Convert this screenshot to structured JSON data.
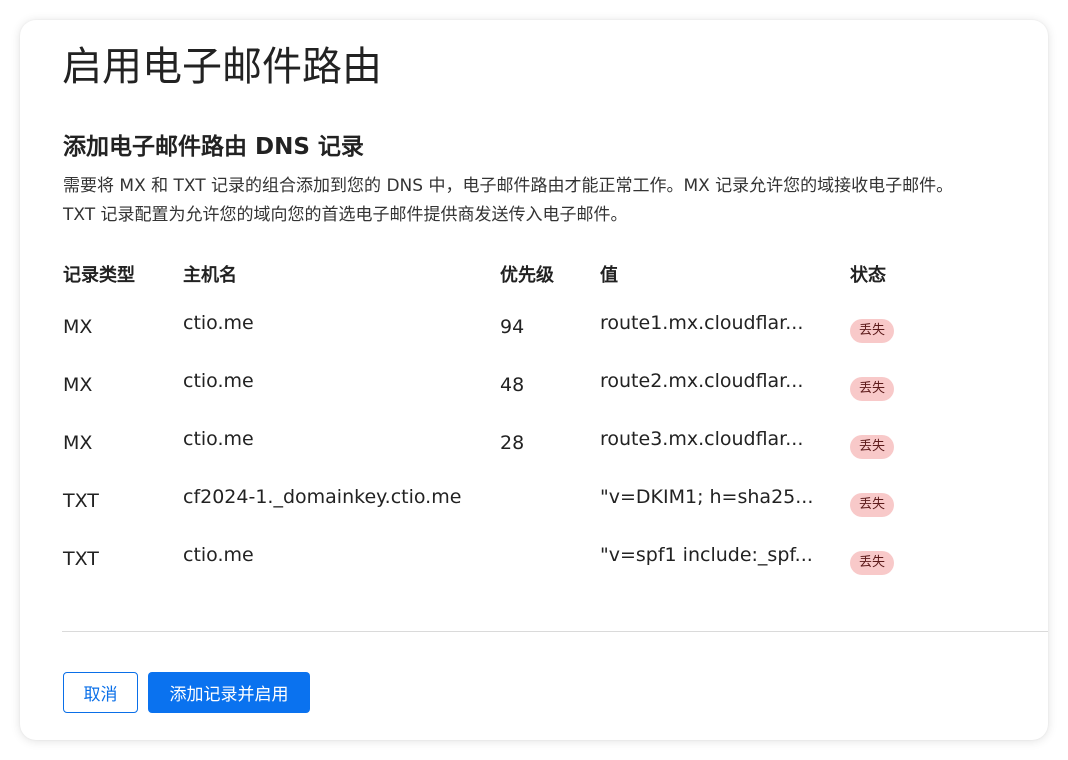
{
  "page": {
    "title": "启用电子邮件路由"
  },
  "section": {
    "title": "添加电子邮件路由 DNS 记录",
    "description": "需要将 MX 和 TXT 记录的组合添加到您的 DNS 中，电子邮件路由才能正常工作。MX 记录允许您的域接收电子邮件。TXT 记录配置为允许您的域向您的首选电子邮件提供商发送传入电子邮件。"
  },
  "table": {
    "headers": {
      "type": "记录类型",
      "hostname": "主机名",
      "priority": "优先级",
      "value": "值",
      "status": "状态"
    },
    "rows": [
      {
        "type": "MX",
        "hostname": "ctio.me",
        "priority": "94",
        "value": "route1.mx.cloudflar...",
        "status": "丢失"
      },
      {
        "type": "MX",
        "hostname": "ctio.me",
        "priority": "48",
        "value": "route2.mx.cloudflar...",
        "status": "丢失"
      },
      {
        "type": "MX",
        "hostname": "ctio.me",
        "priority": "28",
        "value": "route3.mx.cloudflar...",
        "status": "丢失"
      },
      {
        "type": "TXT",
        "hostname": "cf2024-1._domainkey.ctio.me",
        "priority": "",
        "value": "\"v=DKIM1; h=sha25...",
        "status": "丢失"
      },
      {
        "type": "TXT",
        "hostname": "ctio.me",
        "priority": "",
        "value": "\"v=spf1 include:_spf...",
        "status": "丢失"
      }
    ]
  },
  "actions": {
    "cancel_label": "取消",
    "submit_label": "添加记录并启用"
  },
  "colors": {
    "accent": "#0a72ef",
    "status_missing_bg": "#f8c9c9",
    "status_missing_text": "#5c1a1a"
  }
}
